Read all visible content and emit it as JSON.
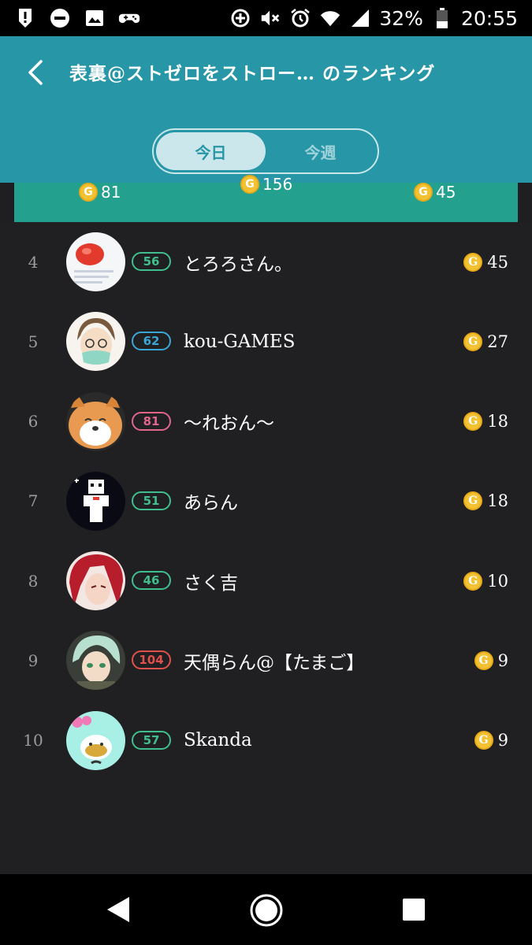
{
  "status_bar": {
    "battery_percent": "32%",
    "time": "20:55"
  },
  "header": {
    "title": "表裏@ストゼロをストロー… のランキング",
    "tabs": [
      {
        "label": "今日",
        "active": true
      },
      {
        "label": "今週",
        "active": false
      }
    ]
  },
  "podium": {
    "scores": [
      "81",
      "156",
      "45"
    ]
  },
  "rankings": [
    {
      "rank": "4",
      "level": "56",
      "level_color": "#3fbf8e",
      "name": "とろろさん。",
      "score": "45"
    },
    {
      "rank": "5",
      "level": "62",
      "level_color": "#3aa7d6",
      "name": "kou-GAMES",
      "score": "27"
    },
    {
      "rank": "6",
      "level": "81",
      "level_color": "#e0668c",
      "name": "〜れおん〜",
      "score": "18"
    },
    {
      "rank": "7",
      "level": "51",
      "level_color": "#3fbf8e",
      "name": "あらん",
      "score": "18"
    },
    {
      "rank": "8",
      "level": "46",
      "level_color": "#3fbf8e",
      "name": "さく吉",
      "score": "10"
    },
    {
      "rank": "9",
      "level": "104",
      "level_color": "#e0504d",
      "name": "天偶らん@【たまご】",
      "score": "9"
    },
    {
      "rank": "10",
      "level": "57",
      "level_color": "#3fbf8e",
      "name": "Skanda",
      "score": "9"
    }
  ],
  "icons": {
    "coin": "G"
  }
}
